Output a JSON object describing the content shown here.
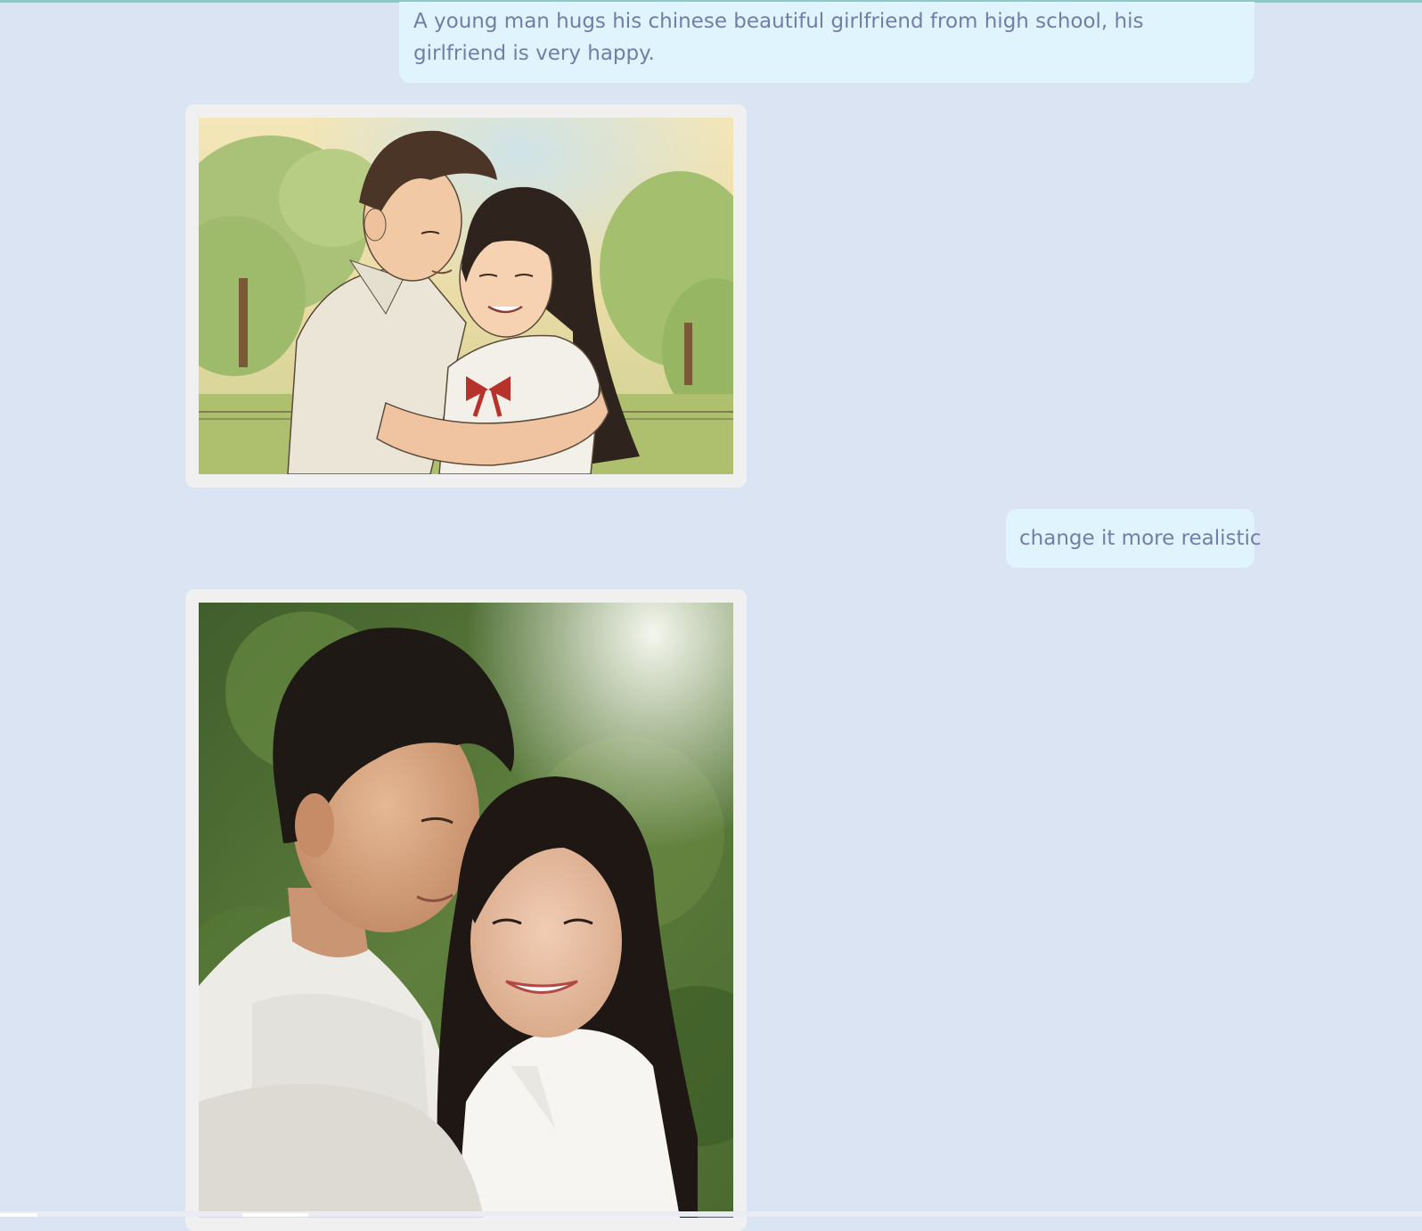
{
  "messages": [
    {
      "role": "user",
      "text": "A young man hugs his chinese beautiful girlfriend from high school, his girlfriend is very happy."
    },
    {
      "role": "assistant",
      "image": "watercolor-illustration-couple-hug"
    },
    {
      "role": "user",
      "text": "change it more realistic"
    },
    {
      "role": "assistant",
      "image": "photo-realistic-couple-hug"
    }
  ],
  "colors": {
    "page_background": "#dbe4f2",
    "user_bubble": "#dff4fd",
    "user_text": "#6f7fa8",
    "image_card": "#f0f0f0"
  }
}
